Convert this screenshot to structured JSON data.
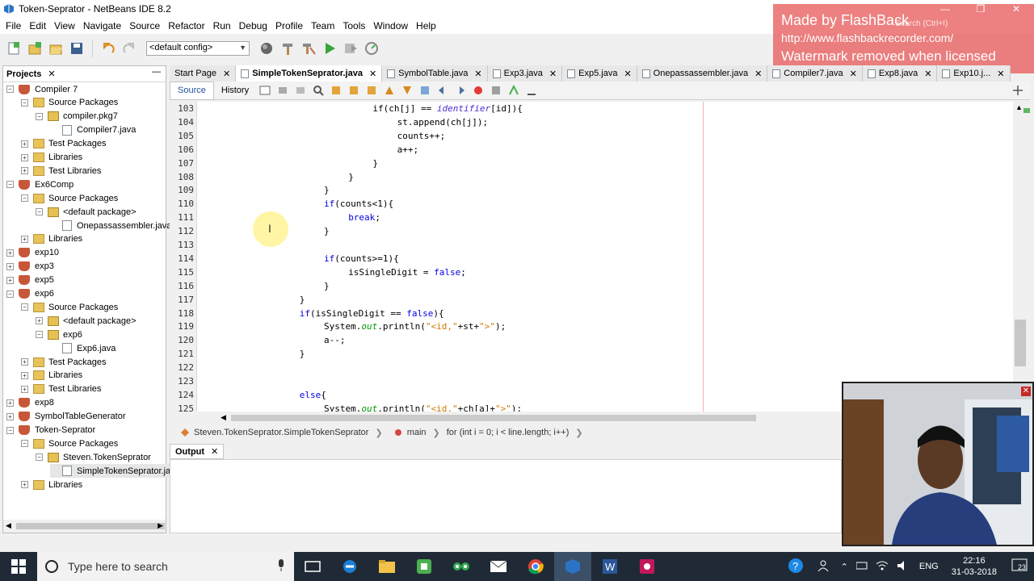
{
  "window": {
    "title": "Token-Seprator - NetBeans IDE 8.2"
  },
  "menu": [
    "File",
    "Edit",
    "View",
    "Navigate",
    "Source",
    "Refactor",
    "Run",
    "Debug",
    "Profile",
    "Team",
    "Tools",
    "Window",
    "Help"
  ],
  "toolbar": {
    "config": "<default config>"
  },
  "watermark": {
    "line1": "Made by FlashBack",
    "line2": "http://www.flashbackrecorder.com/",
    "line3": "Watermark removed when licensed",
    "search_placeholder": "Search (Ctrl+I)"
  },
  "projects": {
    "title": "Projects",
    "tree": [
      {
        "label": "Compiler 7",
        "level": 0,
        "icon": "project",
        "toggle": "−"
      },
      {
        "label": "Source Packages",
        "level": 1,
        "icon": "folder",
        "toggle": "−"
      },
      {
        "label": "compiler.pkg7",
        "level": 2,
        "icon": "package",
        "toggle": "−"
      },
      {
        "label": "Compiler7.java",
        "level": 3,
        "icon": "file",
        "toggle": ""
      },
      {
        "label": "Test Packages",
        "level": 1,
        "icon": "folder",
        "toggle": "+"
      },
      {
        "label": "Libraries",
        "level": 1,
        "icon": "folder",
        "toggle": "+"
      },
      {
        "label": "Test Libraries",
        "level": 1,
        "icon": "folder",
        "toggle": "+"
      },
      {
        "label": "Ex6Comp",
        "level": 0,
        "icon": "project",
        "toggle": "−"
      },
      {
        "label": "Source Packages",
        "level": 1,
        "icon": "folder",
        "toggle": "−"
      },
      {
        "label": "<default package>",
        "level": 2,
        "icon": "package",
        "toggle": "−"
      },
      {
        "label": "Onepassassembler.java",
        "level": 3,
        "icon": "file",
        "toggle": ""
      },
      {
        "label": "Libraries",
        "level": 1,
        "icon": "folder",
        "toggle": "+"
      },
      {
        "label": "exp10",
        "level": 0,
        "icon": "project",
        "toggle": "+"
      },
      {
        "label": "exp3",
        "level": 0,
        "icon": "project",
        "toggle": "+"
      },
      {
        "label": "exp5",
        "level": 0,
        "icon": "project",
        "toggle": "+"
      },
      {
        "label": "exp6",
        "level": 0,
        "icon": "project",
        "toggle": "−"
      },
      {
        "label": "Source Packages",
        "level": 1,
        "icon": "folder",
        "toggle": "−"
      },
      {
        "label": "<default package>",
        "level": 2,
        "icon": "package",
        "toggle": "+"
      },
      {
        "label": "exp6",
        "level": 2,
        "icon": "package",
        "toggle": "−"
      },
      {
        "label": "Exp6.java",
        "level": 3,
        "icon": "file",
        "toggle": ""
      },
      {
        "label": "Test Packages",
        "level": 1,
        "icon": "folder",
        "toggle": "+"
      },
      {
        "label": "Libraries",
        "level": 1,
        "icon": "folder",
        "toggle": "+"
      },
      {
        "label": "Test Libraries",
        "level": 1,
        "icon": "folder",
        "toggle": "+"
      },
      {
        "label": "exp8",
        "level": 0,
        "icon": "project",
        "toggle": "+"
      },
      {
        "label": "SymbolTableGenerator",
        "level": 0,
        "icon": "project",
        "toggle": "+"
      },
      {
        "label": "Token-Seprator",
        "level": 0,
        "icon": "project",
        "toggle": "−"
      },
      {
        "label": "Source Packages",
        "level": 1,
        "icon": "folder",
        "toggle": "−"
      },
      {
        "label": "Steven.TokenSeprator",
        "level": 2,
        "icon": "package",
        "toggle": "−"
      },
      {
        "label": "SimpleTokenSeprator.java",
        "level": 3,
        "icon": "file",
        "toggle": ""
      },
      {
        "label": "Libraries",
        "level": 1,
        "icon": "folder",
        "toggle": "+"
      }
    ]
  },
  "editor": {
    "tabs": [
      {
        "label": "Start Page",
        "active": false
      },
      {
        "label": "SimpleTokenSeprator.java",
        "active": true
      },
      {
        "label": "SymbolTable.java",
        "active": false
      },
      {
        "label": "Exp3.java",
        "active": false
      },
      {
        "label": "Exp5.java",
        "active": false
      },
      {
        "label": "Onepassassembler.java",
        "active": false
      },
      {
        "label": "Compiler7.java",
        "active": false
      },
      {
        "label": "Exp8.java",
        "active": false
      },
      {
        "label": "Exp10.j...",
        "active": false
      }
    ],
    "source_label": "Source",
    "history_label": "History",
    "code": [
      {
        "n": "103",
        "indent": 28,
        "html": "if(ch[j] == <span class='it'>identifier</span>[id]){"
      },
      {
        "n": "104",
        "indent": 32,
        "html": "st.append(ch[j]);"
      },
      {
        "n": "105",
        "indent": 32,
        "html": "counts++;"
      },
      {
        "n": "106",
        "indent": 32,
        "html": "a++;"
      },
      {
        "n": "107",
        "indent": 28,
        "html": "}"
      },
      {
        "n": "108",
        "indent": 24,
        "html": "}"
      },
      {
        "n": "109",
        "indent": 20,
        "html": "}"
      },
      {
        "n": "110",
        "indent": 20,
        "html": "<span class='kw'>if</span>(counts&lt;1){"
      },
      {
        "n": "111",
        "indent": 24,
        "html": "<span class='kw'>break</span>;"
      },
      {
        "n": "112",
        "indent": 20,
        "html": "}"
      },
      {
        "n": "113",
        "indent": 0,
        "html": ""
      },
      {
        "n": "114",
        "indent": 20,
        "html": "<span class='kw'>if</span>(counts&gt;=1){"
      },
      {
        "n": "115",
        "indent": 24,
        "html": "isSingleDigit = <span class='kw'>false</span>;"
      },
      {
        "n": "116",
        "indent": 20,
        "html": "}"
      },
      {
        "n": "117",
        "indent": 16,
        "html": "}"
      },
      {
        "n": "118",
        "indent": 16,
        "html": "<span class='kw'>if</span>(isSingleDigit == <span class='kw'>false</span>){"
      },
      {
        "n": "119",
        "indent": 20,
        "html": "System.<span class='fld'>out</span>.println(<span class='st'>\"&lt;id,\"</span>+st+<span class='st'>\"&gt;\"</span>);"
      },
      {
        "n": "120",
        "indent": 20,
        "html": "a--;"
      },
      {
        "n": "121",
        "indent": 16,
        "html": "}"
      },
      {
        "n": "122",
        "indent": 0,
        "html": ""
      },
      {
        "n": "123",
        "indent": 0,
        "html": ""
      },
      {
        "n": "124",
        "indent": 16,
        "html": "<span class='kw'>else</span>{"
      },
      {
        "n": "125",
        "indent": 20,
        "html": "System.<span class='fld'>out</span>.println(<span class='st'>\"&lt;id,\"</span>+ch[a]+<span class='st'>\"&gt;\"</span>);"
      }
    ]
  },
  "breadcrumb": {
    "class": "Steven.TokenSeprator.SimpleTokenSeprator",
    "method": "main",
    "loop": "for (int i = 0; i < line.length; i++)"
  },
  "output": {
    "tab_label": "Output"
  },
  "taskbar": {
    "search_placeholder": "Type here to search",
    "time": "22:16",
    "date": "31-03-2018",
    "lang": "ENG",
    "notifications": "23"
  }
}
